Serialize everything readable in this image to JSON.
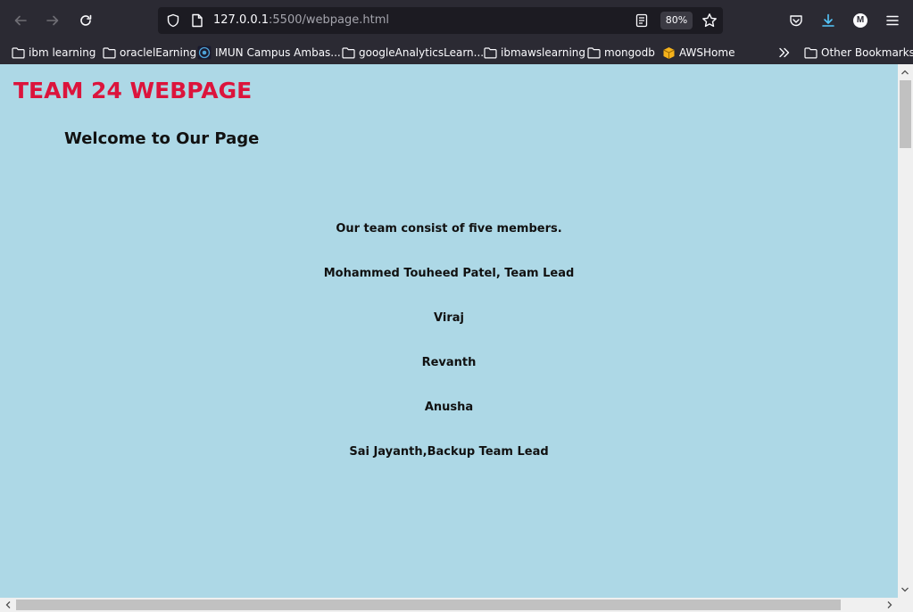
{
  "browser": {
    "url_host": "127.0.0.1",
    "url_path": ":5500/webpage.html",
    "zoom": "80%",
    "avatar_letter": "M"
  },
  "bookmarks": [
    {
      "label": "ibm learning",
      "icon": "folder-icon"
    },
    {
      "label": "oraclelEarning",
      "icon": "folder-icon"
    },
    {
      "label": "IMUN Campus Ambas...",
      "icon": "site-favicon-icon"
    },
    {
      "label": "googleAnalyticsLearn...",
      "icon": "folder-icon"
    },
    {
      "label": "ibmawslearning",
      "icon": "folder-icon"
    },
    {
      "label": "mongodb",
      "icon": "folder-icon"
    },
    {
      "label": "AWSHome",
      "icon": "package-icon"
    }
  ],
  "other_bookmarks": "Other Bookmarks",
  "page": {
    "heading": "TEAM 24 WEBPAGE",
    "welcome": "Welcome to Our Page",
    "team_lines": [
      "Our team consist of five members.",
      "Mohammed Touheed Patel, Team Lead",
      "Viraj",
      "Revanth",
      "Anusha",
      "Sai Jayanth,Backup Team Lead"
    ]
  },
  "colors": {
    "page_background": "#add8e6",
    "heading": "#dc143c",
    "browser_chrome": "#2b2a33",
    "download_accent": "#54c7fc"
  }
}
